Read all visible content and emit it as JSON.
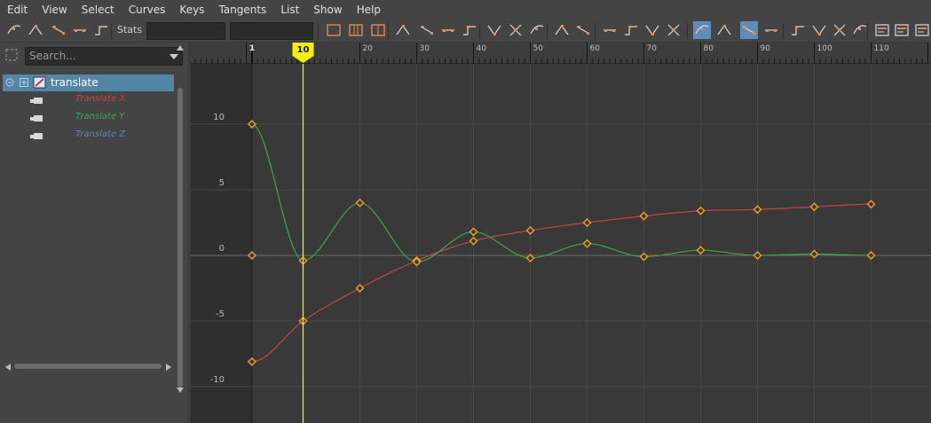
{
  "menubar": {
    "items": [
      "Edit",
      "View",
      "Select",
      "Curves",
      "Keys",
      "Tangents",
      "List",
      "Show",
      "Help"
    ]
  },
  "toolbar": {
    "stats_label": "Stats",
    "icons": [
      "move-nearest-picked-key-icon",
      "insert-keys-icon",
      "lattice-deform-keys-icon",
      "region-keys-icon",
      "retime-keys-icon",
      "frame-all-icon",
      "frame-playback-range-icon",
      "center-current-time-icon",
      "auto-tangents-icon",
      "spline-tangents-icon",
      "clamped-tangents-icon",
      "linear-tangents-icon",
      "flat-tangents-icon",
      "step-tangents-icon",
      "plateau-tangents-icon",
      "buffer-curve-snapshot-icon",
      "swap-buffer-curve-icon",
      "break-tangents-icon",
      "unify-tangents-icon",
      "free-tangent-weight-icon",
      "lock-tangent-weight-icon",
      "auto-load-selection-icon",
      "load-selected-objects-icon",
      "time-snap-icon",
      "value-snap-icon",
      "normalize-curves-icon",
      "denormalize-curves-icon",
      "pre-infinity-icon",
      "post-infinity-icon",
      "dope-sheet-icon",
      "trax-editor-icon",
      "time-editor-icon"
    ]
  },
  "outliner": {
    "search_placeholder": "Search...",
    "node": "translate",
    "channels": [
      {
        "label": "Translate X",
        "color": "#c8424a"
      },
      {
        "label": "Translate Y",
        "color": "#3ea34f"
      },
      {
        "label": "Translate Z",
        "color": "#5b83c2"
      }
    ]
  },
  "graph": {
    "current_frame": 10,
    "current_frame_label": "10",
    "start_frame_label": "1",
    "ruler_labels": [
      "20",
      "30",
      "40",
      "50",
      "60",
      "70",
      "80",
      "90",
      "100",
      "110"
    ],
    "value_labels": [
      "10",
      "5",
      "0",
      "-5",
      "-10"
    ],
    "playhead_color": "#f2f200",
    "key_color": "#f0a020"
  },
  "chart_data": {
    "type": "line",
    "x_range": [
      -10,
      120
    ],
    "y_range": [
      -12.5,
      15
    ],
    "x_ticks": [
      20,
      30,
      40,
      50,
      60,
      70,
      80,
      90,
      100,
      110
    ],
    "y_ticks": [
      10,
      5,
      0,
      -5,
      -10
    ],
    "series": [
      {
        "name": "Translate X",
        "color": "#c8424a",
        "points": [
          [
            1,
            -8.1
          ],
          [
            10,
            -5.0
          ],
          [
            20,
            -2.5
          ],
          [
            30,
            -0.4
          ],
          [
            40,
            1.1
          ],
          [
            50,
            1.9
          ],
          [
            60,
            2.5
          ],
          [
            70,
            3.0
          ],
          [
            80,
            3.4
          ],
          [
            90,
            3.5
          ],
          [
            100,
            3.7
          ],
          [
            110,
            3.9
          ]
        ]
      },
      {
        "name": "Translate Y",
        "color": "#3ea34f",
        "points": [
          [
            1,
            10.0
          ],
          [
            10,
            -0.4
          ],
          [
            20,
            4.0
          ],
          [
            30,
            -0.5
          ],
          [
            40,
            1.8
          ],
          [
            50,
            -0.2
          ],
          [
            60,
            0.9
          ],
          [
            70,
            -0.1
          ],
          [
            80,
            0.4
          ],
          [
            90,
            0.0
          ],
          [
            100,
            0.1
          ],
          [
            110,
            0.0
          ]
        ]
      },
      {
        "name": "Translate Z",
        "color": "#5b83c2",
        "points": [
          [
            1,
            0.0
          ]
        ]
      }
    ]
  }
}
